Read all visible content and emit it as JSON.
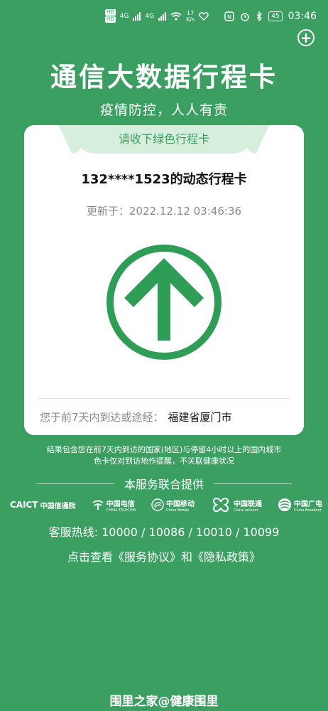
{
  "status_bar": {
    "hd1": "HD",
    "hd2": "HD",
    "net1": "4G",
    "net2": "4G",
    "speed_value": "17",
    "speed_unit": "K/s",
    "battery": "45",
    "time": "03:46"
  },
  "header": {
    "title": "通信大数据行程卡",
    "subtitle": "疫情防控，人人有责"
  },
  "card": {
    "banner": "请收下绿色行程卡",
    "title": "132****1523的动态行程卡",
    "update_time": "更新于：2022.12.12 03:46:36",
    "route_label": "您于前7天内到达或途经：",
    "route_city": "福建省厦门市",
    "arrow_color": "#2e9d56"
  },
  "note": {
    "line1": "结果包含您在前7天内到访的国家(地区)与停留4小时以上的国内城市",
    "line2": "色卡仅对到访地作提醒，不关联健康状况"
  },
  "services": {
    "heading": "本服务联合提供",
    "logos": [
      {
        "mark": "CAICT",
        "name": "中国信通院",
        "en": ""
      },
      {
        "mark": "",
        "name": "中国电信",
        "en": "CHINA TELECOM"
      },
      {
        "mark": "",
        "name": "中国移动",
        "en": "China Mobile"
      },
      {
        "mark": "",
        "name": "中国联通",
        "en": "China unicom"
      },
      {
        "mark": "",
        "name": "中国广电",
        "en": "China Broadnet"
      }
    ]
  },
  "hotline": "客服热线: 10000 / 10086 / 10010 / 10099",
  "agreement": "点击查看《服务协议》和《隐私政策》",
  "watermark": "围里之家@健康围里",
  "colors": {
    "background": "#3a9f60",
    "banner_bg": "#d6efdc",
    "accent": "#3a9f60"
  }
}
